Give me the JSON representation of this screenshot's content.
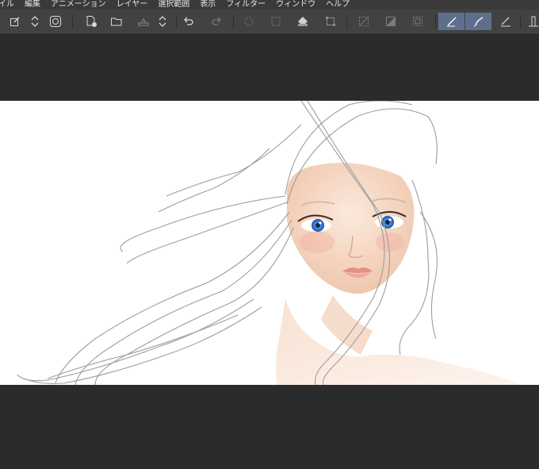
{
  "menu": {
    "items": [
      "イル",
      "編集",
      "アニメーション",
      "レイヤー",
      "選択範囲",
      "表示",
      "フィルター",
      "ウィンドウ",
      "ヘルプ"
    ]
  },
  "toolbar": {
    "buttons": [
      {
        "name": "edit-page-icon",
        "enabled": true
      },
      {
        "name": "updown-stepper-icon",
        "enabled": true
      },
      {
        "name": "clip-studio-icon",
        "enabled": true
      },
      {
        "name": "new-file-icon",
        "enabled": true
      },
      {
        "name": "open-folder-icon",
        "enabled": true
      },
      {
        "name": "save-icon",
        "enabled": false
      },
      {
        "name": "updown-stepper-icon",
        "enabled": true
      },
      {
        "name": "undo-icon",
        "enabled": true
      },
      {
        "name": "redo-icon",
        "enabled": false
      },
      {
        "name": "loading-icon",
        "enabled": false
      },
      {
        "name": "selection-icon",
        "enabled": false
      },
      {
        "name": "fill-icon",
        "enabled": true
      },
      {
        "name": "transform-icon",
        "enabled": false
      },
      {
        "name": "hide-selection-icon",
        "enabled": false
      },
      {
        "name": "layer-icon",
        "enabled": false
      },
      {
        "name": "crop-icon",
        "enabled": false
      },
      {
        "name": "pen-icon",
        "enabled": true,
        "active": true
      },
      {
        "name": "brush-icon",
        "enabled": true,
        "active": true
      },
      {
        "name": "ruler-pen-icon",
        "enabled": true
      },
      {
        "name": "ruler-icon",
        "enabled": true
      }
    ]
  },
  "colors": {
    "menubar": "#3a3a3a",
    "toolbar": "#424242",
    "workspace": "#2b2b2b",
    "active_button": "#5d6f8c",
    "skin": "#f5d9c6",
    "iris": "#3b7fd6",
    "lips": "#e9a49a"
  }
}
